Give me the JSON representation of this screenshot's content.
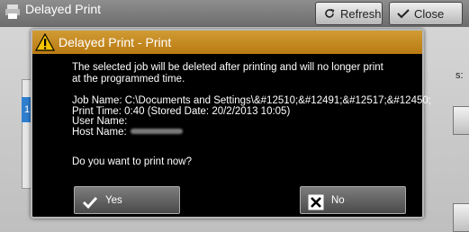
{
  "background": {
    "title": "Delayed Print",
    "refresh_label": "Refresh",
    "close_label": "Close",
    "tab_number": "1",
    "side_label": "s:"
  },
  "dialog": {
    "title": "Delayed Print - Print",
    "message": "The selected job will be deleted after printing and will no longer print at the programmed time.",
    "job_name_line": "Job Name: C:\\Documents and Settings\\&#12510;&#12491;&#12517;&#12450;",
    "print_time_line": "Print Time: 0:40 (Stored Date: 20/2/2013 10:05)",
    "user_name_line": "User Name:",
    "host_name_line": "Host Name:",
    "question": "Do you want to print now?",
    "yes_label": "Yes",
    "no_label": "No"
  },
  "colors": {
    "header": "#c58a1f",
    "dialog_bg": "#000000",
    "button": "#5f5f5f"
  },
  "icons": {
    "warning": "warning-icon",
    "yes": "checkmark-icon",
    "no": "close-x-icon",
    "refresh": "refresh-icon",
    "close": "checkmark-icon"
  }
}
